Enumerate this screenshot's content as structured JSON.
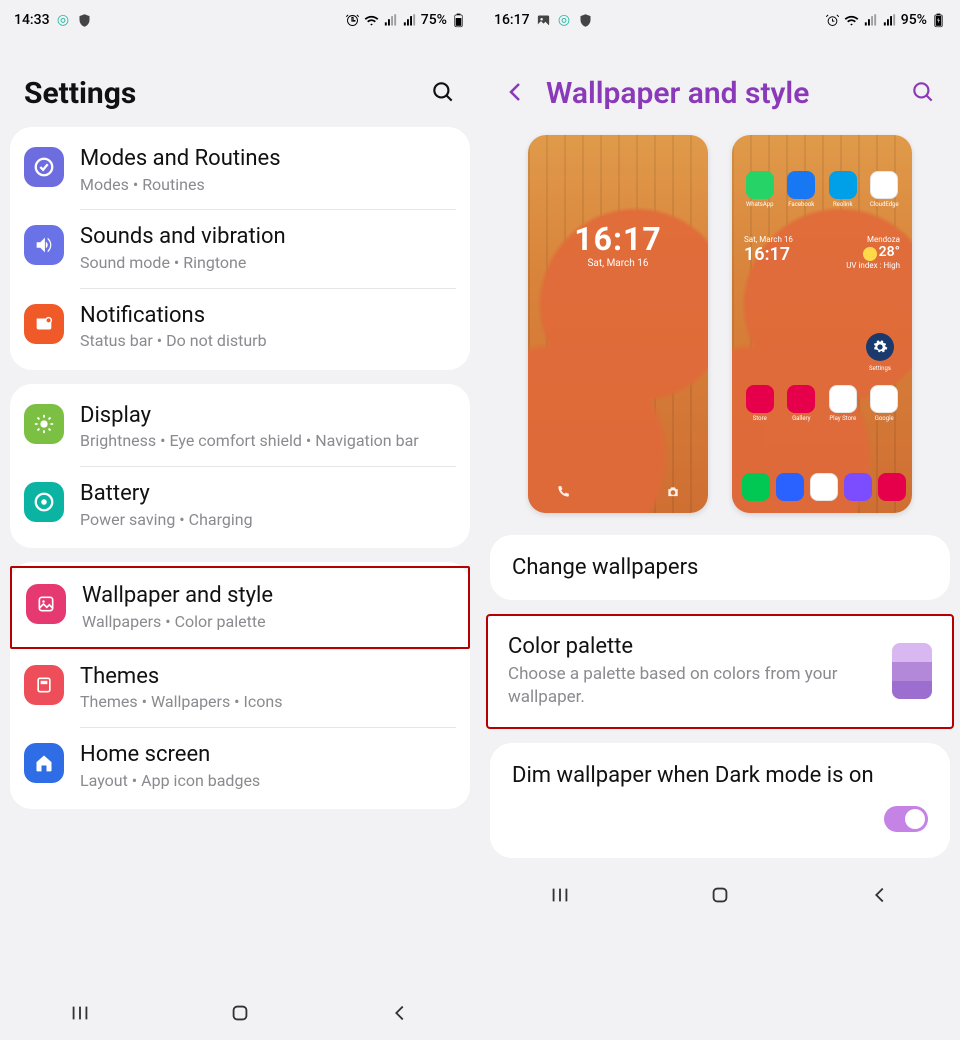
{
  "left": {
    "status": {
      "time": "14:33",
      "battery": "75%"
    },
    "header": {
      "title": "Settings"
    },
    "groups": [
      {
        "items": [
          {
            "key": "modes",
            "title": "Modes and Routines",
            "sub": "Modes  •  Routines",
            "color": "#6d6de0"
          },
          {
            "key": "sounds",
            "title": "Sounds and vibration",
            "sub": "Sound mode  •  Ringtone",
            "color": "#6a72e8"
          },
          {
            "key": "notif",
            "title": "Notifications",
            "sub": "Status bar  •  Do not disturb",
            "color": "#f05a28"
          }
        ]
      },
      {
        "items": [
          {
            "key": "display",
            "title": "Display",
            "sub": "Brightness  •  Eye comfort shield  •  Navigation bar",
            "color": "#7bc043"
          },
          {
            "key": "battery",
            "title": "Battery",
            "sub": "Power saving  •  Charging",
            "color": "#0bb3a2"
          }
        ]
      },
      {
        "highlight_index": 0,
        "items": [
          {
            "key": "wallpaper",
            "title": "Wallpaper and style",
            "sub": "Wallpapers  •  Color palette",
            "color": "#e63972"
          },
          {
            "key": "themes",
            "title": "Themes",
            "sub": "Themes  •  Wallpapers  •  Icons",
            "color": "#ee4e5a"
          },
          {
            "key": "home",
            "title": "Home screen",
            "sub": "Layout  •  App icon badges",
            "color": "#2e6de6"
          }
        ]
      }
    ]
  },
  "right": {
    "status": {
      "time": "16:17",
      "battery": "95%"
    },
    "header": {
      "title": "Wallpaper and style"
    },
    "lock_preview": {
      "time": "16:17",
      "date": "Sat, March 16"
    },
    "home_preview": {
      "top_apps": [
        {
          "label": "WhatsApp",
          "color": "#25d366"
        },
        {
          "label": "Facebook",
          "color": "#1877f2"
        },
        {
          "label": "Reolink",
          "color": "#00a0e9"
        },
        {
          "label": "CloudEdge",
          "color": "#ffffff"
        }
      ],
      "time_widget": {
        "date": "Sat, March 16",
        "time": "16:17"
      },
      "weather": {
        "temp": "28°",
        "line": "Mendoza",
        "extra": "UV index : High"
      },
      "settings_label": "Settings",
      "row_apps": [
        {
          "label": "Store",
          "color": "#e6004c"
        },
        {
          "label": "Gallery",
          "color": "#e6004c"
        },
        {
          "label": "Play Store",
          "color": "#ffffff"
        },
        {
          "label": "Google",
          "color": "#ffffff"
        }
      ],
      "dock": [
        {
          "color": "#00c853"
        },
        {
          "color": "#2962ff"
        },
        {
          "color": "#ffffff"
        },
        {
          "color": "#7c4dff"
        },
        {
          "color": "#e6004c"
        }
      ]
    },
    "change_wallpapers": "Change wallpapers",
    "color_palette": {
      "title": "Color palette",
      "sub": "Choose a palette based on colors from your wallpaper.",
      "swatch": [
        "#d9b8f2",
        "#b388d9",
        "#9b6ecf"
      ]
    },
    "dim": {
      "title": "Dim wallpaper when Dark mode is on",
      "on": true
    }
  }
}
